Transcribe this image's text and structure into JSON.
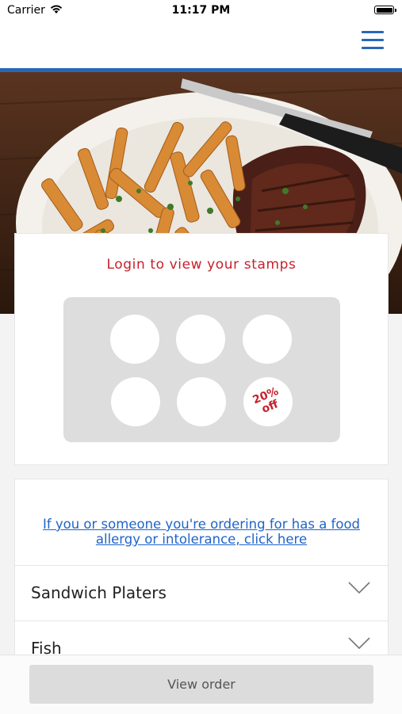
{
  "status_bar": {
    "carrier": "Carrier",
    "time": "11:17 PM"
  },
  "header": {
    "menu_icon": "hamburger-menu-icon",
    "accent_color": "#2a66b8"
  },
  "hero": {
    "image": "steak-and-fries-plate"
  },
  "loyalty": {
    "title": "Login to view your stamps",
    "stamps_total": 6,
    "stamps_collected": 0,
    "reward_label": "20%\noff",
    "accent_color": "#c8202c"
  },
  "allergy": {
    "link_text": "If you or someone you're ordering for has a food allergy or intolerance, click here"
  },
  "categories": [
    {
      "label": "Sandwich Platers",
      "icon": "chevron-down-icon"
    },
    {
      "label": "Fish",
      "icon": "chevron-down-icon"
    }
  ],
  "footer": {
    "view_order_label": "View order"
  }
}
